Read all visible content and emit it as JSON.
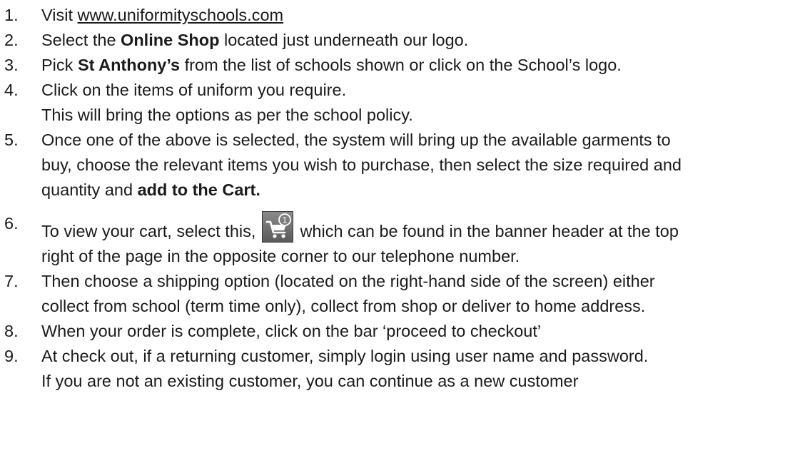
{
  "steps": [
    {
      "num": "1.",
      "pre": "Visit ",
      "link": "www.uniformityschools.com"
    },
    {
      "num": "2.",
      "pre": "Select the ",
      "bold": "Online Shop",
      "post": " located just underneath our logo."
    },
    {
      "num": "3.",
      "pre": "Pick ",
      "bold": "St Anthony’s",
      "post": " from the list of schools shown or click on the School’s logo."
    },
    {
      "num": "4.",
      "line1": "Click on the items of uniform you require.",
      "line2": "This will bring the options as per the school policy."
    },
    {
      "num": "5.",
      "line1": "Once one of the above is selected, the system will bring up the available garments to",
      "line2": "buy, choose the relevant items you wish to purchase, then select the size required and",
      "line3_pre": "quantity and ",
      "line3_bold": "add to the Cart."
    },
    {
      "num": "6.",
      "pre": "To view your cart, select this, ",
      "post": " which can be found in the banner header at the top",
      "line2": "right of the page in the opposite corner to our telephone number.",
      "icon": "shopping-cart-icon",
      "badge": "1"
    },
    {
      "num": "7.",
      "line1": "Then choose a shipping option (located on the right-hand side of the screen) either",
      "line2": "collect from school (term time only), collect from shop or deliver to home address."
    },
    {
      "num": "8.",
      "line1": "When your order is complete, click on the bar ‘proceed to checkout’"
    },
    {
      "num": "9.",
      "line1": "At check out, if a returning customer, simply login using user name and password.",
      "line2": "If you are not an existing customer, you can continue as a new customer"
    }
  ]
}
